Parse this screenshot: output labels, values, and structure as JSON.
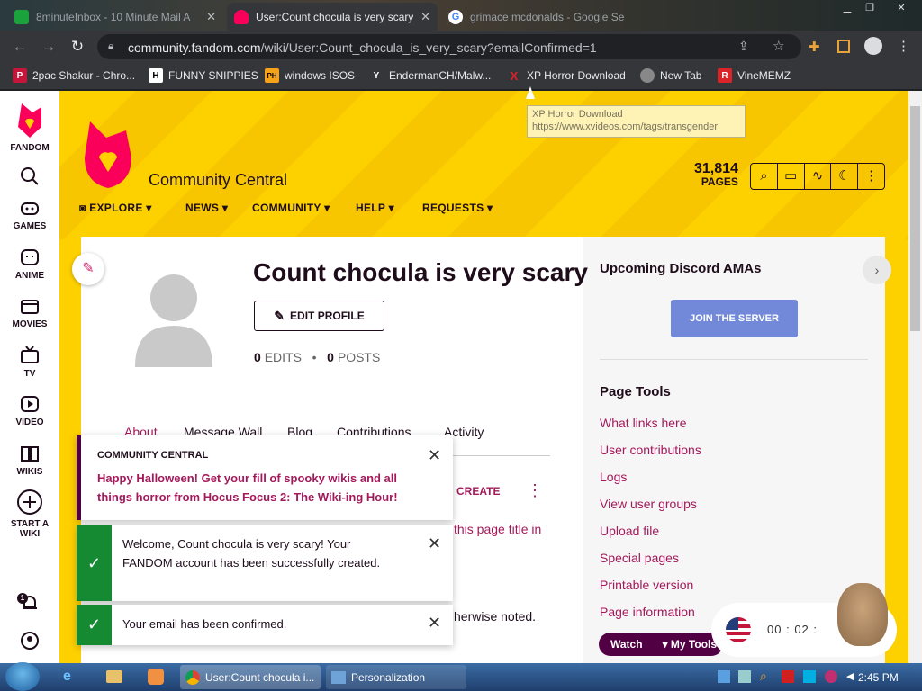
{
  "browser": {
    "tabs": [
      {
        "title": "8minuteInbox - 10 Minute Mail A",
        "active": false
      },
      {
        "title": "User:Count chocula is very scary",
        "active": true
      },
      {
        "title": "grimace mcdonalds - Google Se",
        "active": false
      }
    ],
    "url_host": "community.fandom.com",
    "url_path": "/wiki/User:Count_chocula_is_very_scary?emailConfirmed=1",
    "bookmarks": [
      {
        "label": "2pac Shakur - Chro...",
        "icon": "P"
      },
      {
        "label": "FUNNY SNIPPIES",
        "icon": "H"
      },
      {
        "label": "windows ISOS",
        "icon": "PH"
      },
      {
        "label": "EndermanCH/Malw...",
        "icon": "Y"
      },
      {
        "label": "XP Horror Download",
        "icon": "X"
      },
      {
        "label": "New Tab",
        "icon": "globe"
      },
      {
        "label": "VineMEMZ",
        "icon": "R"
      }
    ],
    "tooltip": {
      "title": "XP Horror Download",
      "url": "https://www.xvideos.com/tags/transgender"
    }
  },
  "global_nav": {
    "items": [
      {
        "label": "FANDOM"
      },
      {
        "label": "GAMES"
      },
      {
        "label": "ANIME"
      },
      {
        "label": "MOVIES"
      },
      {
        "label": "TV"
      },
      {
        "label": "VIDEO"
      },
      {
        "label": "WIKIS"
      },
      {
        "label": "START A WIKI"
      }
    ],
    "notification_count": "1"
  },
  "wiki": {
    "name": "Community Central",
    "nav": [
      "EXPLORE",
      "NEWS",
      "COMMUNITY",
      "HELP",
      "REQUESTS"
    ],
    "pages_count": "31,814",
    "pages_label": "PAGES"
  },
  "profile": {
    "username": "Count chocula is very scary",
    "edit_label": "EDIT PROFILE",
    "edits_count": "0",
    "edits_label": "EDITS",
    "posts_count": "0",
    "posts_label": "POSTS",
    "tabs": [
      "About",
      "Message Wall",
      "Blog",
      "Contributions",
      "Activity"
    ],
    "create_label": "CREATE",
    "partial_text_1": "this page title in",
    "partial_text_2": "herwise noted."
  },
  "rail": {
    "discord_heading": "Upcoming Discord AMAs",
    "join_label": "JOIN THE SERVER",
    "tools_heading": "Page Tools",
    "tools_links": [
      "What links here",
      "User contributions",
      "Logs",
      "View user groups",
      "Upload file",
      "Special pages",
      "Printable version",
      "Page information"
    ],
    "watch_label": "Watch",
    "my_tools_label": "My Tools"
  },
  "notifications": [
    {
      "heading": "COMMUNITY CENTRAL",
      "text": "Happy Halloween! Get your fill of spooky wikis and all things horror from Hocus Focus 2: The Wiki-ing Hour!"
    },
    {
      "text": "Welcome, Count chocula is very scary! Your FANDOM account has been successfully created."
    },
    {
      "text": "Your email has been confirmed."
    }
  ],
  "overlay_timer": {
    "minutes": "00",
    "seconds": "02"
  },
  "taskbar": {
    "items": [
      {
        "label": "User:Count chocula i..."
      },
      {
        "label": "Personalization"
      }
    ],
    "clock": "2:45 PM"
  },
  "colors": {
    "fandom_pink": "#fa005a",
    "link": "#a3195b",
    "accent_dark": "#520044",
    "banner_yellow": "#fdd000",
    "discord": "#7289da",
    "success_green": "#158a33"
  }
}
